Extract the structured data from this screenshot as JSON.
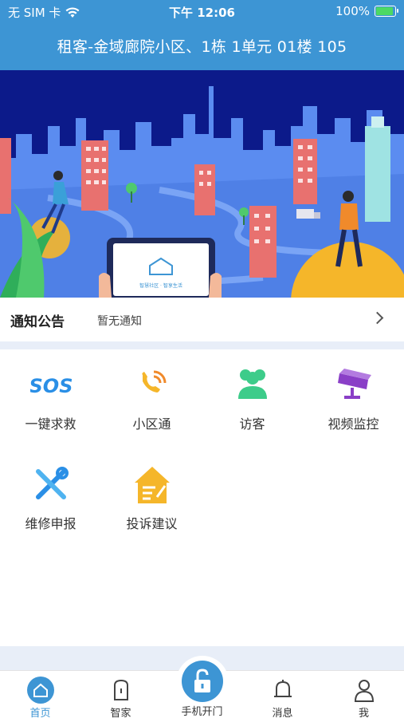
{
  "status_bar": {
    "carrier": "无 SIM 卡",
    "time": "下午 12:06",
    "battery": "100%"
  },
  "header": {
    "address": "租客-金域廊院小区、1栋 1单元 01楼 105"
  },
  "banner": {
    "tablet_caption": "智慧社区 · 智享生活"
  },
  "notice": {
    "title": "通知公告",
    "text": "暂无通知"
  },
  "services": [
    {
      "label": "一键求救",
      "icon": "sos-icon"
    },
    {
      "label": "小区通",
      "icon": "phone-icon"
    },
    {
      "label": "访客",
      "icon": "visitors-icon"
    },
    {
      "label": "视频监控",
      "icon": "camera-icon"
    },
    {
      "label": "维修申报",
      "icon": "tools-icon"
    },
    {
      "label": "投诉建议",
      "icon": "complaint-icon"
    }
  ],
  "tabbar": {
    "items": [
      {
        "label": "首页",
        "icon": "home-icon",
        "active": true
      },
      {
        "label": "智家",
        "icon": "smart-home-icon",
        "active": false
      },
      {
        "label": "手机开门",
        "icon": "lock-icon",
        "active": false
      },
      {
        "label": "消息",
        "icon": "bell-icon",
        "active": false
      },
      {
        "label": "我",
        "icon": "user-icon",
        "active": false
      }
    ]
  },
  "colors": {
    "primary": "#3d95d4",
    "banner_bg": "#0c1a8a",
    "banner_city": "#5b8cf0",
    "page_bg": "#e8eef8"
  }
}
